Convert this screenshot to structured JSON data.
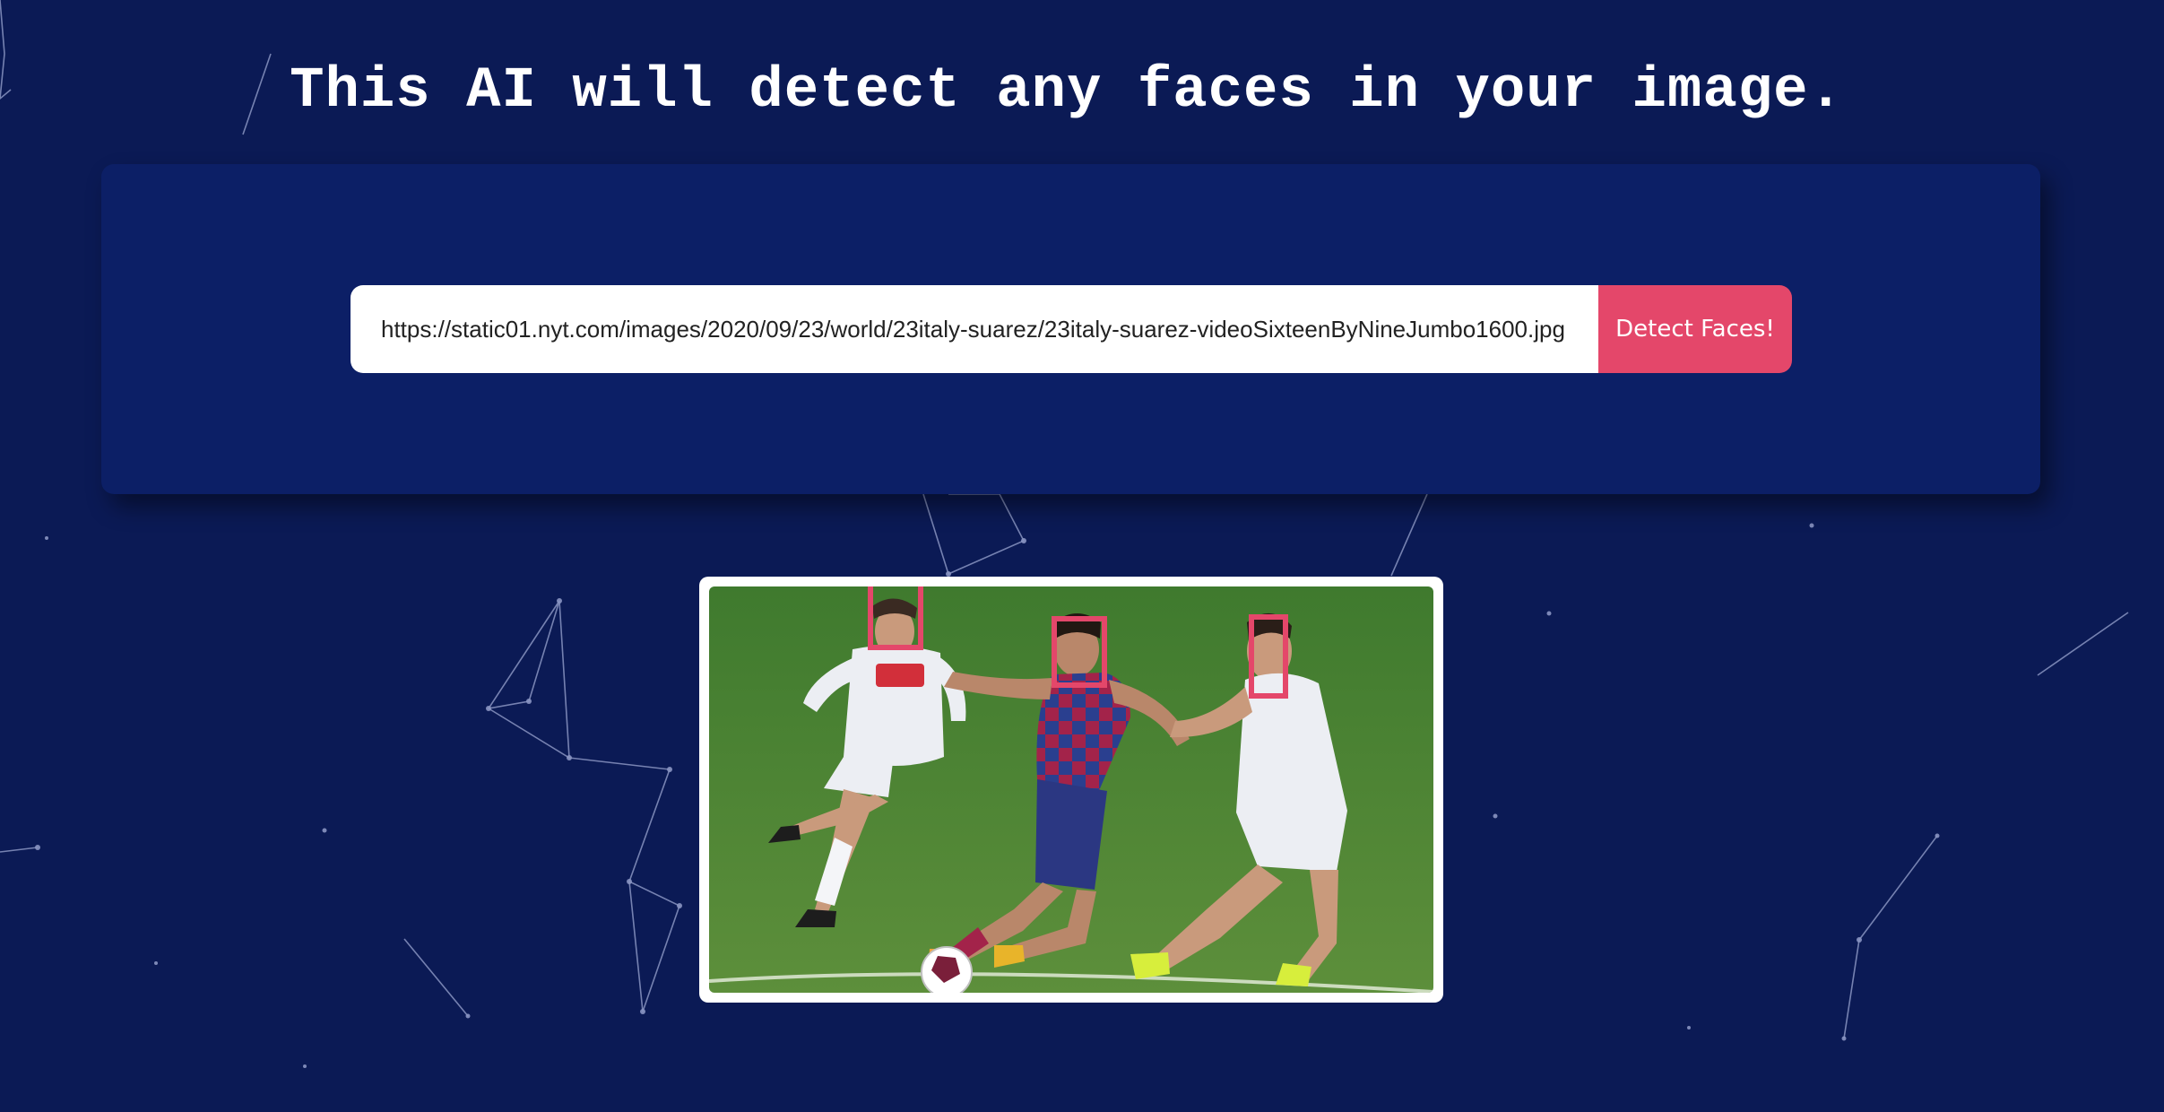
{
  "header": {
    "title": "This AI will detect any faces in your image."
  },
  "form": {
    "image_url": "https://static01.nyt.com/images/2020/09/23/world/23italy-suarez/23italy-suarez-videoSixteenByNineJumbo1600.jpg",
    "submit_label": "Detect Faces!"
  },
  "result": {
    "face_count": 3
  },
  "colors": {
    "background": "#0b1a55",
    "panel": "#0c1f66",
    "accent": "#e4476a",
    "text": "#ffffff"
  }
}
